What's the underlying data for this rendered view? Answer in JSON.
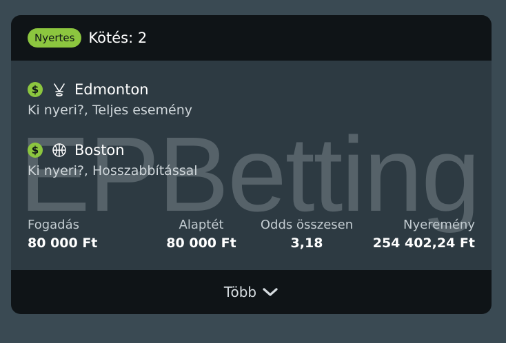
{
  "header": {
    "status_badge": "Nyertes",
    "bet_count": "Kötés: 2"
  },
  "watermark": "EPBetting",
  "selections": [
    {
      "sport_icon": "ice-hockey-icon",
      "team": "Edmonton",
      "market": "Ki nyeri?, Teljes esemény"
    },
    {
      "sport_icon": "basketball-icon",
      "team": "Boston",
      "market": "Ki nyeri?, Hosszabbítással"
    }
  ],
  "stats": {
    "stake": {
      "label": "Fogadás",
      "value": "80 000 Ft"
    },
    "base": {
      "label": "Alaptét",
      "value": "80 000 Ft"
    },
    "odds": {
      "label": "Odds összesen",
      "value": "3,18"
    },
    "winnings": {
      "label": "Nyeremény",
      "value": "254 402,24 Ft"
    }
  },
  "footer": {
    "more_label": "Több"
  },
  "colors": {
    "accent": "#8cc63f",
    "card": "#2d3a42",
    "header": "#0f1417",
    "background": "#3a4a53"
  }
}
